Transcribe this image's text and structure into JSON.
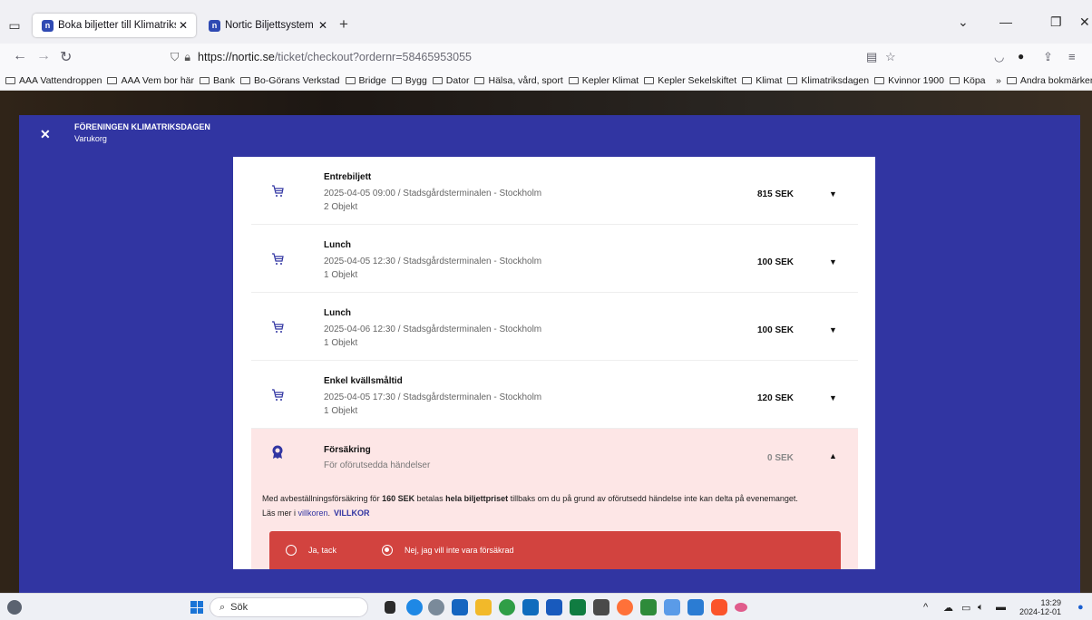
{
  "browser": {
    "tabs": [
      {
        "title": "Boka biljetter till Klimatriksdag",
        "favicon": "n"
      },
      {
        "title": "Nortic Biljettsystem - Arrangör",
        "favicon": "n"
      }
    ],
    "url_host": "https://nortic.se",
    "url_path": "/ticket/checkout?ordernr=58465953055",
    "bookmarks": [
      "AAA Vattendroppen",
      "AAA Vem bor här",
      "Bank",
      "Bo-Görans Verkstad",
      "Bridge",
      "Bygg",
      "Dator",
      "Hälsa, vård, sport",
      "Kepler Klimat",
      "Kepler Sekelskiftet",
      "Klimat",
      "Klimatriksdagen",
      "Kvinnor 1900",
      "Köpa"
    ],
    "other_bookmarks": "Andra bokmärken"
  },
  "header": {
    "org": "FÖRENINGEN KLIMATRIKSDAGEN",
    "subtitle": "Varukorg"
  },
  "items": [
    {
      "title": "Entrebiljett",
      "detail": "2025-04-05 09:00 / Stadsgårdsterminalen - Stockholm",
      "qty": "2 Objekt",
      "price": "815 SEK"
    },
    {
      "title": "Lunch",
      "detail": "2025-04-05 12:30 / Stadsgårdsterminalen - Stockholm",
      "qty": "1 Objekt",
      "price": "100 SEK"
    },
    {
      "title": "Lunch",
      "detail": "2025-04-06 12:30 / Stadsgårdsterminalen - Stockholm",
      "qty": "1 Objekt",
      "price": "100 SEK"
    },
    {
      "title": "Enkel kvällsmåltid",
      "detail": "2025-04-05 17:30 / Stadsgårdsterminalen - Stockholm",
      "qty": "1 Objekt",
      "price": "120 SEK"
    }
  ],
  "insurance": {
    "title": "Försäkring",
    "subtitle": "För oförutsedda händelser",
    "price": "0 SEK",
    "desc_1": "Med avbeställningsförsäkring för ",
    "desc_amount": "160 SEK",
    "desc_2": " betalas ",
    "desc_bold": "hela biljettpriset",
    "desc_3": " tillbaks om du på grund av oförutsedd händelse inte kan delta på evenemanget.",
    "read_more": "Läs mer i ",
    "terms_link": "villkoren",
    "terms_button": "VILLKOR",
    "option_yes": "Ja, tack",
    "option_no": "Nej, jag vill inte vara försäkrad",
    "selected": "no"
  },
  "taskbar": {
    "search": "Sök",
    "time": "13:29",
    "date": "2024-12-01"
  },
  "colors": {
    "overlay": "#3135a2",
    "insurance_bg": "#fde6e6",
    "choice_bar": "#d2433f"
  }
}
